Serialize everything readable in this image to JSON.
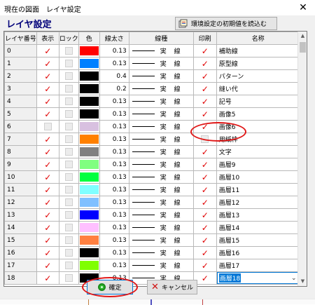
{
  "window": {
    "title": "現在の図面　レイヤ設定",
    "close_glyph": "✕"
  },
  "dialog": {
    "heading": "レイヤ設定",
    "init_button_label": "環境設定の初期値を読込む",
    "ok_label": "確定",
    "cancel_label": "キャンセル"
  },
  "table": {
    "columns": [
      "レイヤ番号",
      "表示",
      "ロック",
      "色",
      "線太さ",
      "線種",
      "印刷",
      "名称"
    ],
    "rows": [
      {
        "no": "0",
        "visible": true,
        "locked": false,
        "color": "#ff0000",
        "width": "0.13",
        "linetype": "実 線",
        "print": true,
        "name": "補助線"
      },
      {
        "no": "1",
        "visible": true,
        "locked": false,
        "color": "#0080ff",
        "width": "0.13",
        "linetype": "実 線",
        "print": true,
        "name": "原型線"
      },
      {
        "no": "2",
        "visible": true,
        "locked": false,
        "color": "#000000",
        "width": "0.4",
        "linetype": "実 線",
        "print": true,
        "name": "パターン"
      },
      {
        "no": "3",
        "visible": true,
        "locked": false,
        "color": "#000000",
        "width": "0.2",
        "linetype": "実 線",
        "print": true,
        "name": "縫い代"
      },
      {
        "no": "4",
        "visible": true,
        "locked": false,
        "color": "#000000",
        "width": "0.13",
        "linetype": "実 線",
        "print": true,
        "name": "記号"
      },
      {
        "no": "5",
        "visible": true,
        "locked": false,
        "color": "#000000",
        "width": "0.13",
        "linetype": "実 線",
        "print": true,
        "name": "画像5"
      },
      {
        "no": "6",
        "visible": false,
        "locked": false,
        "color": "#d8c0e0",
        "width": "0.13",
        "linetype": "実 線",
        "print": true,
        "name": "画像6"
      },
      {
        "no": "7",
        "visible": true,
        "locked": false,
        "color": "#ff8000",
        "width": "0.13",
        "linetype": "実 線",
        "print": false,
        "name": "用紙枠"
      },
      {
        "no": "8",
        "visible": true,
        "locked": false,
        "color": "#808080",
        "width": "0.13",
        "linetype": "実 線",
        "print": true,
        "name": "文字"
      },
      {
        "no": "9",
        "visible": true,
        "locked": false,
        "color": "#80ff80",
        "width": "0.13",
        "linetype": "実 線",
        "print": true,
        "name": "画層9"
      },
      {
        "no": "10",
        "visible": true,
        "locked": false,
        "color": "#00ff40",
        "width": "0.13",
        "linetype": "実 線",
        "print": true,
        "name": "画層10"
      },
      {
        "no": "11",
        "visible": true,
        "locked": false,
        "color": "#80ffff",
        "width": "0.13",
        "linetype": "実 線",
        "print": true,
        "name": "画層11"
      },
      {
        "no": "12",
        "visible": true,
        "locked": false,
        "color": "#80c0ff",
        "width": "0.13",
        "linetype": "実 線",
        "print": true,
        "name": "画層12"
      },
      {
        "no": "13",
        "visible": true,
        "locked": false,
        "color": "#0000ff",
        "width": "0.13",
        "linetype": "実 線",
        "print": true,
        "name": "画層13"
      },
      {
        "no": "14",
        "visible": true,
        "locked": false,
        "color": "#ffc0ff",
        "width": "0.13",
        "linetype": "実 線",
        "print": true,
        "name": "画層14"
      },
      {
        "no": "15",
        "visible": true,
        "locked": false,
        "color": "#ff8040",
        "width": "0.13",
        "linetype": "実 線",
        "print": true,
        "name": "画層15"
      },
      {
        "no": "16",
        "visible": true,
        "locked": false,
        "color": "#000000",
        "width": "0.13",
        "linetype": "実 線",
        "print": true,
        "name": "画層16"
      },
      {
        "no": "17",
        "visible": true,
        "locked": false,
        "color": "#80ff00",
        "width": "0.13",
        "linetype": "実 線",
        "print": true,
        "name": "画層17"
      },
      {
        "no": "18",
        "visible": true,
        "locked": false,
        "color": "#000000",
        "width": "0.13",
        "linetype": "実 線",
        "print": true,
        "name": "画層18"
      }
    ]
  },
  "icons": {
    "checkmark": "✓",
    "scroll_up": "▲",
    "scroll_down": "▼",
    "dropdown": "⌄",
    "cancel_x": "✕"
  }
}
